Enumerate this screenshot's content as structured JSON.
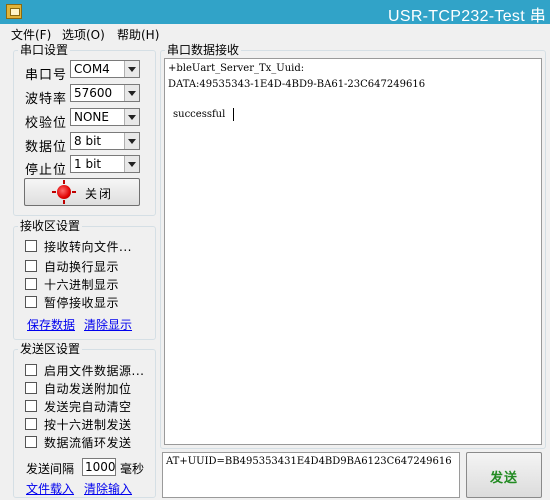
{
  "window": {
    "title": "USR-TCP232-Test 串"
  },
  "menu": {
    "items": [
      "文件(F)",
      "选项(O)",
      "帮助(H)"
    ]
  },
  "serial_settings": {
    "legend": "串口设置",
    "port_label": "串口号",
    "port_value": "COM4",
    "baud_label": "波特率",
    "baud_value": "57600",
    "parity_label": "校验位",
    "parity_value": "NONE",
    "databits_label": "数据位",
    "databits_value": "8 bit",
    "stopbits_label": "停止位",
    "stopbits_value": "1 bit",
    "close_button_label": "关闭",
    "status_led_color": "#e00000"
  },
  "receive_settings": {
    "legend": "接收区设置",
    "options": [
      "接收转向文件...",
      "自动换行显示",
      "十六进制显示",
      "暂停接收显示"
    ],
    "save_link": "保存数据",
    "clear_link": "清除显示"
  },
  "send_settings": {
    "legend": "发送区设置",
    "options": [
      "启用文件数据源...",
      "自动发送附加位",
      "发送完自动清空",
      "按十六进制发送",
      "数据流循环发送"
    ],
    "interval_label": "发送间隔",
    "interval_value": "1000",
    "interval_unit": "毫秒",
    "load_file_link": "文件载入",
    "clear_input_link": "清除输入"
  },
  "receive_panel": {
    "legend": "串口数据接收",
    "lines": [
      "+bleUart_Server_Tx_Uuid:",
      "DATA:49535343-1E4D-4BD9-BA61-23C647249616",
      "successful"
    ]
  },
  "send_panel": {
    "input_text": "AT+UUID=BB495353431E4D4BD9BA6123C647249616",
    "send_button_label": "发送",
    "send_button_color": "#228b22"
  }
}
